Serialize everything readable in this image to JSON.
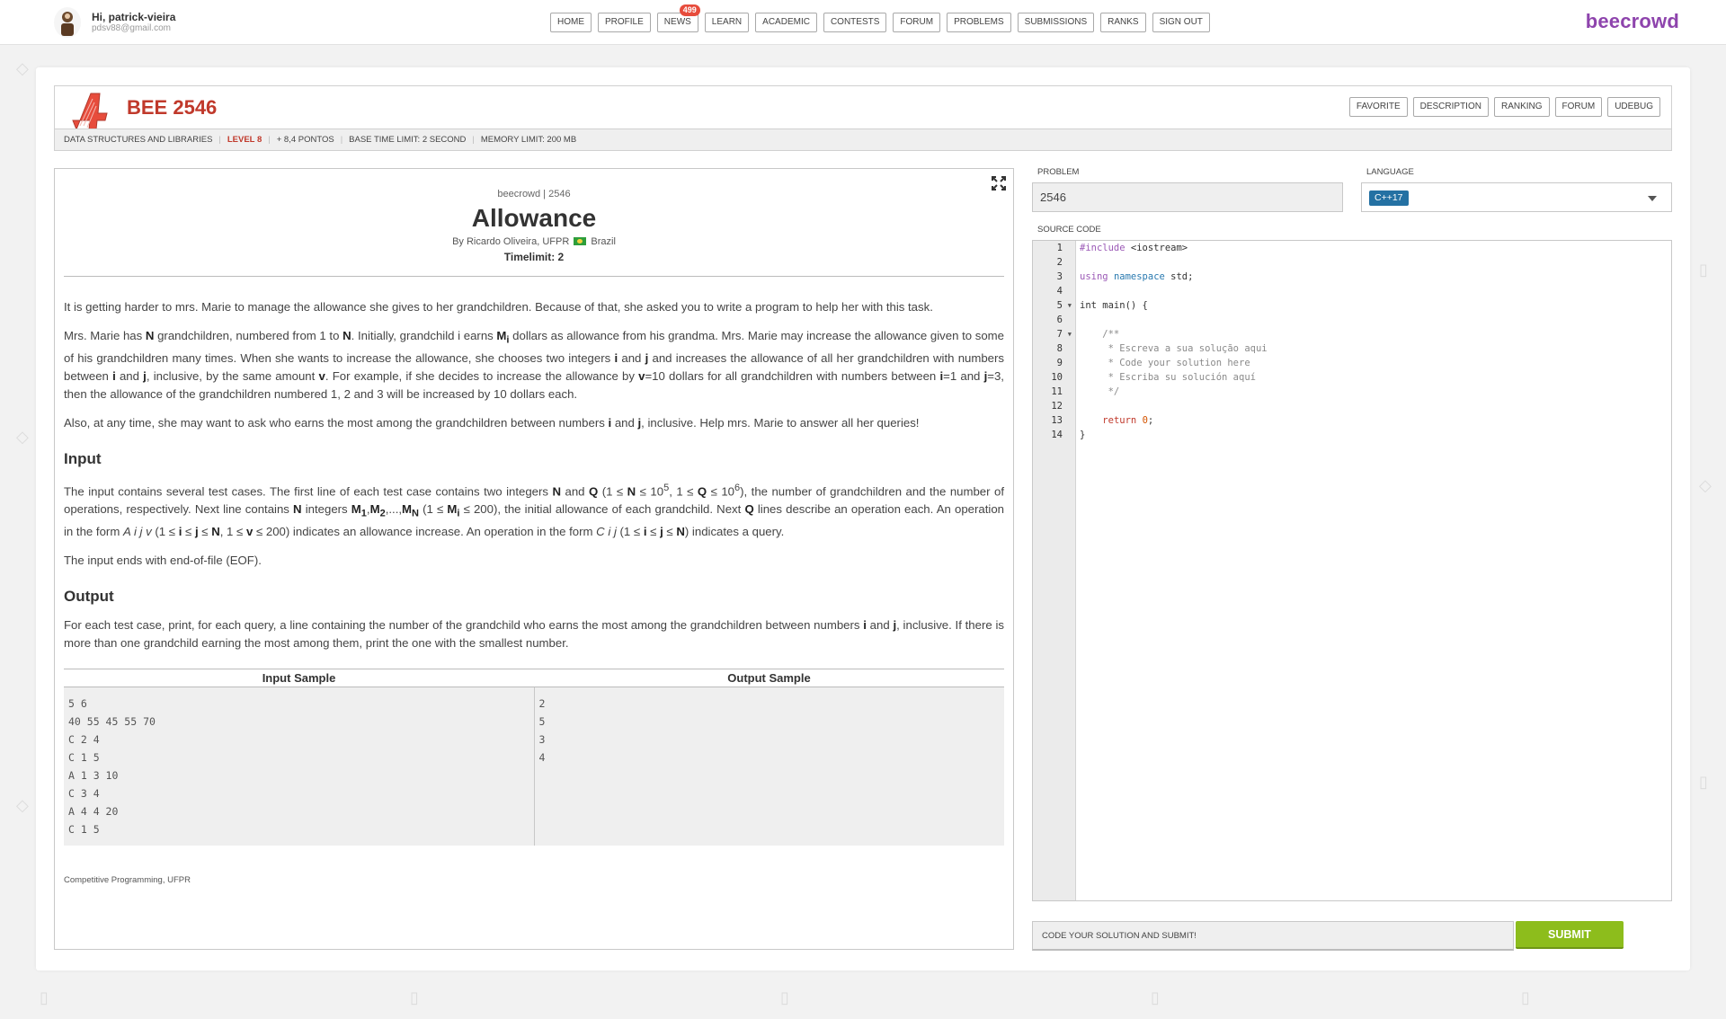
{
  "header": {
    "greeting": "Hi, patrick-vieira",
    "email": "pdsv88@gmail.com",
    "nav": [
      {
        "label": "HOME"
      },
      {
        "label": "PROFILE"
      },
      {
        "label": "NEWS",
        "badge": "499"
      },
      {
        "label": "LEARN"
      },
      {
        "label": "ACADEMIC"
      },
      {
        "label": "CONTESTS"
      },
      {
        "label": "FORUM"
      },
      {
        "label": "PROBLEMS"
      },
      {
        "label": "SUBMISSIONS"
      },
      {
        "label": "RANKS"
      },
      {
        "label": "SIGN OUT"
      }
    ],
    "brand": "beecrowd",
    "brand_color": "#8e44ad"
  },
  "problem_header": {
    "title": "BEE 2546",
    "tabs": [
      "FAVORITE",
      "DESCRIPTION",
      "RANKING",
      "FORUM",
      "UDEBUG"
    ],
    "meta": {
      "category": "DATA STRUCTURES AND LIBRARIES",
      "level": "LEVEL 8",
      "points": "+ 8,4 PONTOS",
      "time_limit": "BASE TIME LIMIT: 2 SECOND",
      "memory_limit": "MEMORY LIMIT: 200 MB"
    }
  },
  "description": {
    "source": "beecrowd | 2546",
    "title": "Allowance",
    "author_prefix": "By Ricardo Oliveira, UFPR",
    "country": "Brazil",
    "timelimit": "Timelimit: 2",
    "input_heading": "Input",
    "output_heading": "Output",
    "input_ends": "The input ends with end-of-file (EOF).",
    "footer": "Competitive Programming, UFPR",
    "samples": {
      "input_header": "Input Sample",
      "output_header": "Output Sample",
      "input_lines": [
        "5 6",
        "40 55 45 55 70",
        "C 2 4",
        "C 1 5",
        "A 1 3 10",
        "C 3 4",
        "A 4 4 20",
        "C 1 5"
      ],
      "output_lines": [
        "2",
        "5",
        "3",
        "4"
      ]
    }
  },
  "editor": {
    "problem_label": "PROBLEM",
    "problem_value": "2546",
    "language_label": "LANGUAGE",
    "language_value": "C++17",
    "source_label": "SOURCE CODE",
    "lines": [
      "1",
      "2",
      "3",
      "4",
      "5",
      "6",
      "7",
      "8",
      "9",
      "10",
      "11",
      "12",
      "13",
      "14"
    ],
    "submit_message": "CODE YOUR SOLUTION AND SUBMIT!",
    "submit_label": "SUBMIT",
    "submit_color": "#8dbd1c"
  }
}
